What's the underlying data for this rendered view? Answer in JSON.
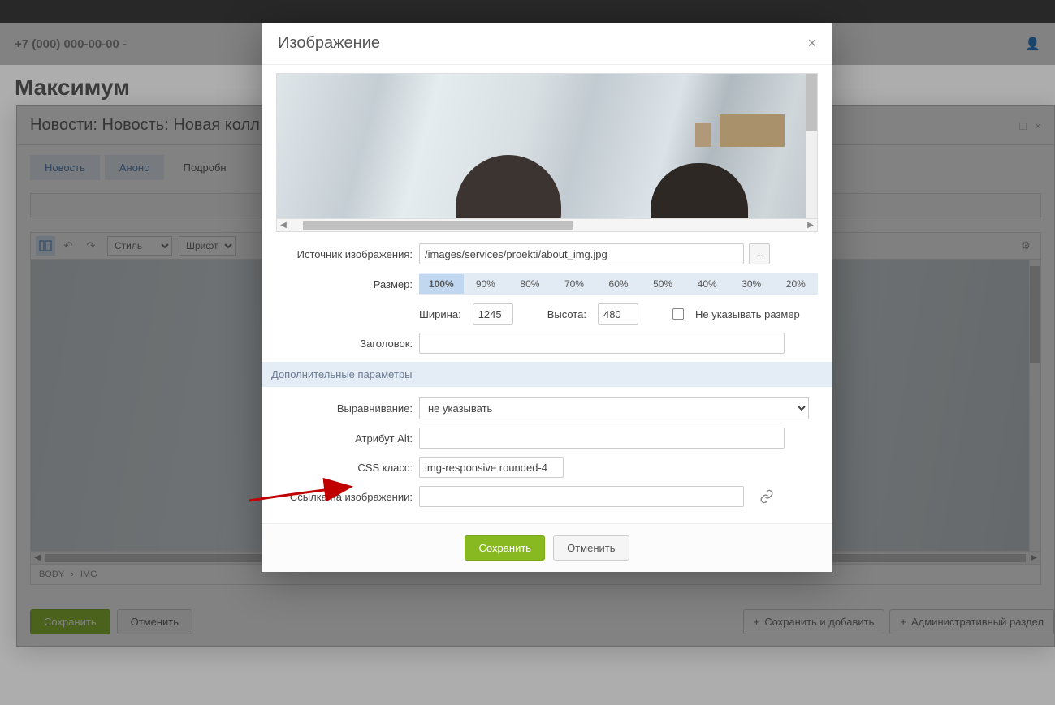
{
  "phone": "+7 (000) 000-00-00 -",
  "brand": "Максимум",
  "editor": {
    "title": "Новости: Новость: Новая колл",
    "tabs": [
      "Новость",
      "Анонс",
      "Подробн"
    ],
    "toolbar": {
      "style": "Стиль",
      "font": "Шрифт"
    },
    "path": [
      "BODY",
      "IMG"
    ],
    "footer": {
      "save": "Сохранить",
      "cancel": "Отменить",
      "save_add": "Сохранить и добавить",
      "admin": "Административный раздел"
    }
  },
  "modal": {
    "title": "Изображение",
    "labels": {
      "source": "Источник изображения:",
      "size": "Размер:",
      "width": "Ширина:",
      "height": "Высота:",
      "nosize": "Не указывать размер",
      "heading": "Заголовок:",
      "extra": "Дополнительные параметры",
      "align": "Выравнивание:",
      "alt": "Атрибут Alt:",
      "css": "CSS класс:",
      "link": "Ссылка на изображении:"
    },
    "values": {
      "source": "/images/services/proekti/about_img.jpg",
      "width": "1245",
      "height": "480",
      "align_option": "не указывать",
      "css": "img-responsive rounded-4"
    },
    "sizes": [
      "100%",
      "90%",
      "80%",
      "70%",
      "60%",
      "50%",
      "40%",
      "30%",
      "20%"
    ],
    "footer": {
      "save": "Сохранить",
      "cancel": "Отменить"
    }
  }
}
